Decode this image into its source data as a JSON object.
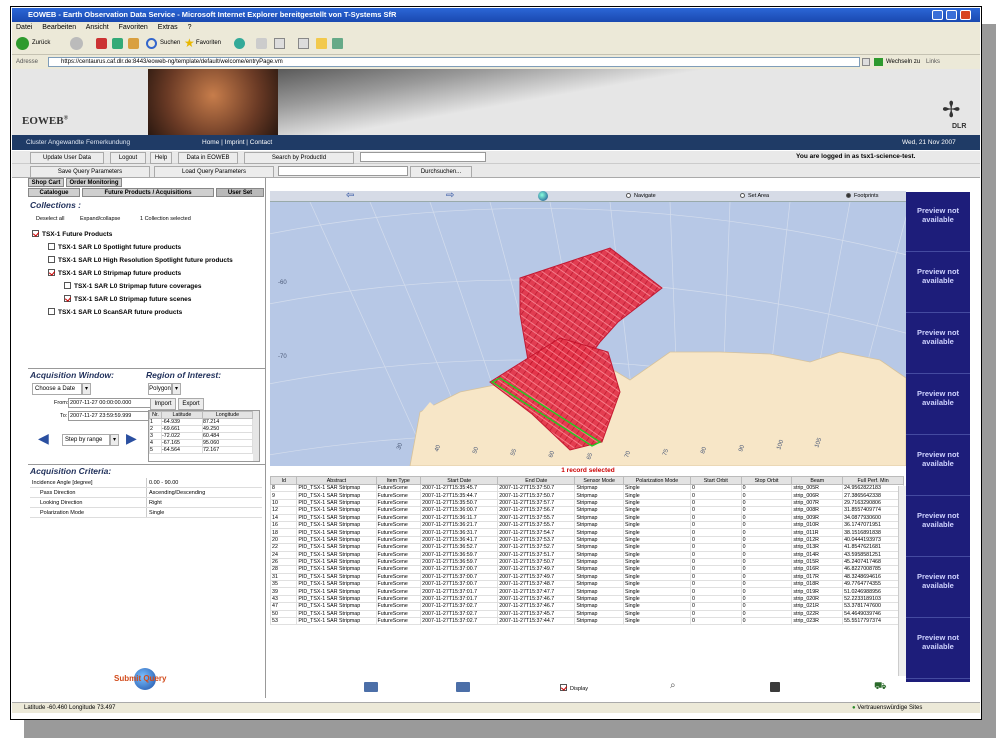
{
  "window": {
    "title": "EOWEB - Earth Observation Data Service - Microsoft Internet Explorer bereitgestellt von T-Systems SfR"
  },
  "menu": [
    "Datei",
    "Bearbeiten",
    "Ansicht",
    "Favoriten",
    "Extras",
    "?"
  ],
  "toolbar": {
    "back": "Zurück",
    "search": "Suchen",
    "favorites": "Favoriten"
  },
  "address": {
    "label": "Adresse",
    "url": "https://centaurus.caf.dlr.de:8443/eoweb-ng/template/default/welcome/entryPage.vm",
    "go": "Wechseln zu",
    "links": "Links"
  },
  "banner": {
    "logo": "EOWEB",
    "reg": "®",
    "dlr": "DLR"
  },
  "nav": {
    "org": "Cluster Angewandte Fernerkundung",
    "links": "Home  |  Imprint  |  Contact",
    "date": "Wed, 21 Nov 2007"
  },
  "actions": {
    "update_user": "Update User Data",
    "logout": "Logout",
    "help": "Help",
    "data_in": "Data in EOWEB",
    "search_pid": "Search by ProductId",
    "logged_in": "You are logged in as tsx1-science-test.",
    "save_query": "Save Query Parameters",
    "load_query": "Load Query Parameters",
    "browse": "Durchsuchen..."
  },
  "tabs": {
    "shop_cart": "Shop Cart",
    "order_mon": "Order Monitoring",
    "catalogue": "Catalogue",
    "future": "Future Products / Acquisitions",
    "user_set": "User Set"
  },
  "collections": {
    "title": "Collections :",
    "deselect": "Deselect all",
    "expand": "Expand/collapse",
    "selected": "1 Collection selected",
    "items": [
      "TSX-1 Future Products",
      "TSX-1 SAR L0 Spotlight future products",
      "TSX-1 SAR L0 High Resolution Spotlight future products",
      "TSX-1 SAR L0 Stripmap future products",
      "TSX-1 SAR L0 Stripmap future coverages",
      "TSX-1 SAR L0 Stripmap future scenes",
      "TSX-1 SAR L0 ScanSAR future products"
    ]
  },
  "acq": {
    "title": "Acquisition Window:",
    "choose": "Choose a Date",
    "from_label": "From:",
    "from": "2007-11-27 00:00:00.000",
    "to_label": "To:",
    "to": "2007-11-27 23:59:59.999",
    "step": "Step by range"
  },
  "roi": {
    "title": "Region of Interest:",
    "shape": "Polygon",
    "import": "Import",
    "export": "Export",
    "headers": [
      "Nr.",
      "Latitude",
      "Longitude"
    ],
    "rows": [
      [
        "1",
        "-64.939",
        "87.214"
      ],
      [
        "2",
        "-69.661",
        "49.250"
      ],
      [
        "3",
        "-72.022",
        "60.484"
      ],
      [
        "4",
        "-67.165",
        "95.060"
      ],
      [
        "5",
        "-64.564",
        "72.167"
      ]
    ]
  },
  "criteria": {
    "title": "Acquisition Criteria:",
    "rows": [
      [
        "Incidence Angle [degree]",
        "0.00 - 90.00"
      ],
      [
        "Pass Direction",
        "Ascending/Descending"
      ],
      [
        "Looking Direction",
        "Right"
      ],
      [
        "Polarization Mode",
        "Single"
      ]
    ]
  },
  "submit": {
    "label": "Submit Query"
  },
  "map": {
    "navigate": "Navigate",
    "set_area": "Set Area",
    "footprints": "Footprints",
    "lat_labels": [
      "-60",
      "-70"
    ],
    "lon_labels": [
      "30",
      "40",
      "50",
      "55",
      "60",
      "65",
      "70",
      "75",
      "80",
      "90",
      "100",
      "105"
    ]
  },
  "results": {
    "selected": "1 record selected",
    "headers": [
      "Id",
      "Abstract",
      "Item Type",
      "Start Date",
      "End Date",
      "Sensor Mode",
      "Polarization Mode",
      "Start Orbit",
      "Stop Orbit",
      "Beam",
      "Full Perf. Min"
    ],
    "rows": [
      [
        "8",
        "PID_TSX-1 SAR Stripmap",
        "FutureScene",
        "2007-11-27T15:35:45.7",
        "2007-11-27T15:37:50.7",
        "Stripmap",
        "Single",
        "0",
        "0",
        "strip_005R",
        "24.9562822183"
      ],
      [
        "9",
        "PID_TSX-1 SAR Stripmap",
        "FutureScene",
        "2007-11-27T15:35:44.7",
        "2007-11-27T15:37:50.7",
        "Stripmap",
        "Single",
        "0",
        "0",
        "strip_006R",
        "27.3865642338"
      ],
      [
        "10",
        "PID_TSX-1 SAR Stripmap",
        "FutureScene",
        "2007-11-27T15:35:50.7",
        "2007-11-27T15:37:57.7",
        "Stripmap",
        "Single",
        "0",
        "0",
        "strip_007R",
        "29.7163290806"
      ],
      [
        "12",
        "PID_TSX-1 SAR Stripmap",
        "FutureScene",
        "2007-11-27T15:36:00.7",
        "2007-11-27T15:37:56.7",
        "Stripmap",
        "Single",
        "0",
        "0",
        "strip_008R",
        "31.8557409774"
      ],
      [
        "14",
        "PID_TSX-1 SAR Stripmap",
        "FutureScene",
        "2007-11-27T15:36:11.7",
        "2007-11-27T15:37:55.7",
        "Stripmap",
        "Single",
        "0",
        "0",
        "strip_009R",
        "34.0877930600"
      ],
      [
        "16",
        "PID_TSX-1 SAR Stripmap",
        "FutureScene",
        "2007-11-27T15:36:21.7",
        "2007-11-27T15:37:55.7",
        "Stripmap",
        "Single",
        "0",
        "0",
        "strip_010R",
        "36.1747071951"
      ],
      [
        "18",
        "PID_TSX-1 SAR Stripmap",
        "FutureScene",
        "2007-11-27T15:36:31.7",
        "2007-11-27T15:37:54.7",
        "Stripmap",
        "Single",
        "0",
        "0",
        "strip_011R",
        "38.1516891838"
      ],
      [
        "20",
        "PID_TSX-1 SAR Stripmap",
        "FutureScene",
        "2007-11-27T15:36:41.7",
        "2007-11-27T15:37:53.7",
        "Stripmap",
        "Single",
        "0",
        "0",
        "strip_012R",
        "40.0444193973"
      ],
      [
        "22",
        "PID_TSX-1 SAR Stripmap",
        "FutureScene",
        "2007-11-27T15:36:52.7",
        "2007-11-27T15:37:52.7",
        "Stripmap",
        "Single",
        "0",
        "0",
        "strip_013R",
        "41.8547621681"
      ],
      [
        "24",
        "PID_TSX-1 SAR Stripmap",
        "FutureScene",
        "2007-11-27T15:36:59.7",
        "2007-11-27T15:37:51.7",
        "Stripmap",
        "Single",
        "0",
        "0",
        "strip_014R",
        "43.5958581251"
      ],
      [
        "26",
        "PID_TSX-1 SAR Stripmap",
        "FutureScene",
        "2007-11-27T15:36:59.7",
        "2007-11-27T15:37:50.7",
        "Stripmap",
        "Single",
        "0",
        "0",
        "strip_015R",
        "45.2407417468"
      ],
      [
        "28",
        "PID_TSX-1 SAR Stripmap",
        "FutureScene",
        "2007-11-27T15:37:00.7",
        "2007-11-27T15:37:49.7",
        "Stripmap",
        "Single",
        "0",
        "0",
        "strip_016R",
        "46.8227008785"
      ],
      [
        "31",
        "PID_TSX-1 SAR Stripmap",
        "FutureScene",
        "2007-11-27T15:37:00.7",
        "2007-11-27T15:37:49.7",
        "Stripmap",
        "Single",
        "0",
        "0",
        "strip_017R",
        "48.3248694616"
      ],
      [
        "35",
        "PID_TSX-1 SAR Stripmap",
        "FutureScene",
        "2007-11-27T15:37:00.7",
        "2007-11-27T15:37:48.7",
        "Stripmap",
        "Single",
        "0",
        "0",
        "strip_018R",
        "49.7764774355"
      ],
      [
        "39",
        "PID_TSX-1 SAR Stripmap",
        "FutureScene",
        "2007-11-27T15:37:01.7",
        "2007-11-27T15:37:47.7",
        "Stripmap",
        "Single",
        "0",
        "0",
        "strip_019R",
        "51.0246988956"
      ],
      [
        "43",
        "PID_TSX-1 SAR Stripmap",
        "FutureScene",
        "2007-11-27T15:37:01.7",
        "2007-11-27T15:37:46.7",
        "Stripmap",
        "Single",
        "0",
        "0",
        "strip_020R",
        "52.2233189103"
      ],
      [
        "47",
        "PID_TSX-1 SAR Stripmap",
        "FutureScene",
        "2007-11-27T15:37:02.7",
        "2007-11-27T15:37:46.7",
        "Stripmap",
        "Single",
        "0",
        "0",
        "strip_021R",
        "53.3781747600"
      ],
      [
        "50",
        "PID_TSX-1 SAR Stripmap",
        "FutureScene",
        "2007-11-27T15:37:02.7",
        "2007-11-27T15:37:45.7",
        "Stripmap",
        "Single",
        "0",
        "0",
        "strip_022R",
        "54.4649039746"
      ],
      [
        "53",
        "PID_TSX-1 SAR Stripmap",
        "FutureScene",
        "2007-11-27T15:37:02.7",
        "2007-11-27T15:37:44.7",
        "Stripmap",
        "Single",
        "0",
        "0",
        "strip_023R",
        "55.5517797374"
      ]
    ]
  },
  "preview": {
    "text": "Preview not available",
    "count": 8
  },
  "bottom": {
    "display": "Display"
  },
  "status": {
    "coords": "Latitude -60.460 Longitude 73.497",
    "zone": "Vertrauenswürdige Sites"
  },
  "colors": {
    "footprint": "#e0102a",
    "selected": "#22cc22",
    "nav": "#1f3b66",
    "preview_bg": "#1d1d7a"
  }
}
